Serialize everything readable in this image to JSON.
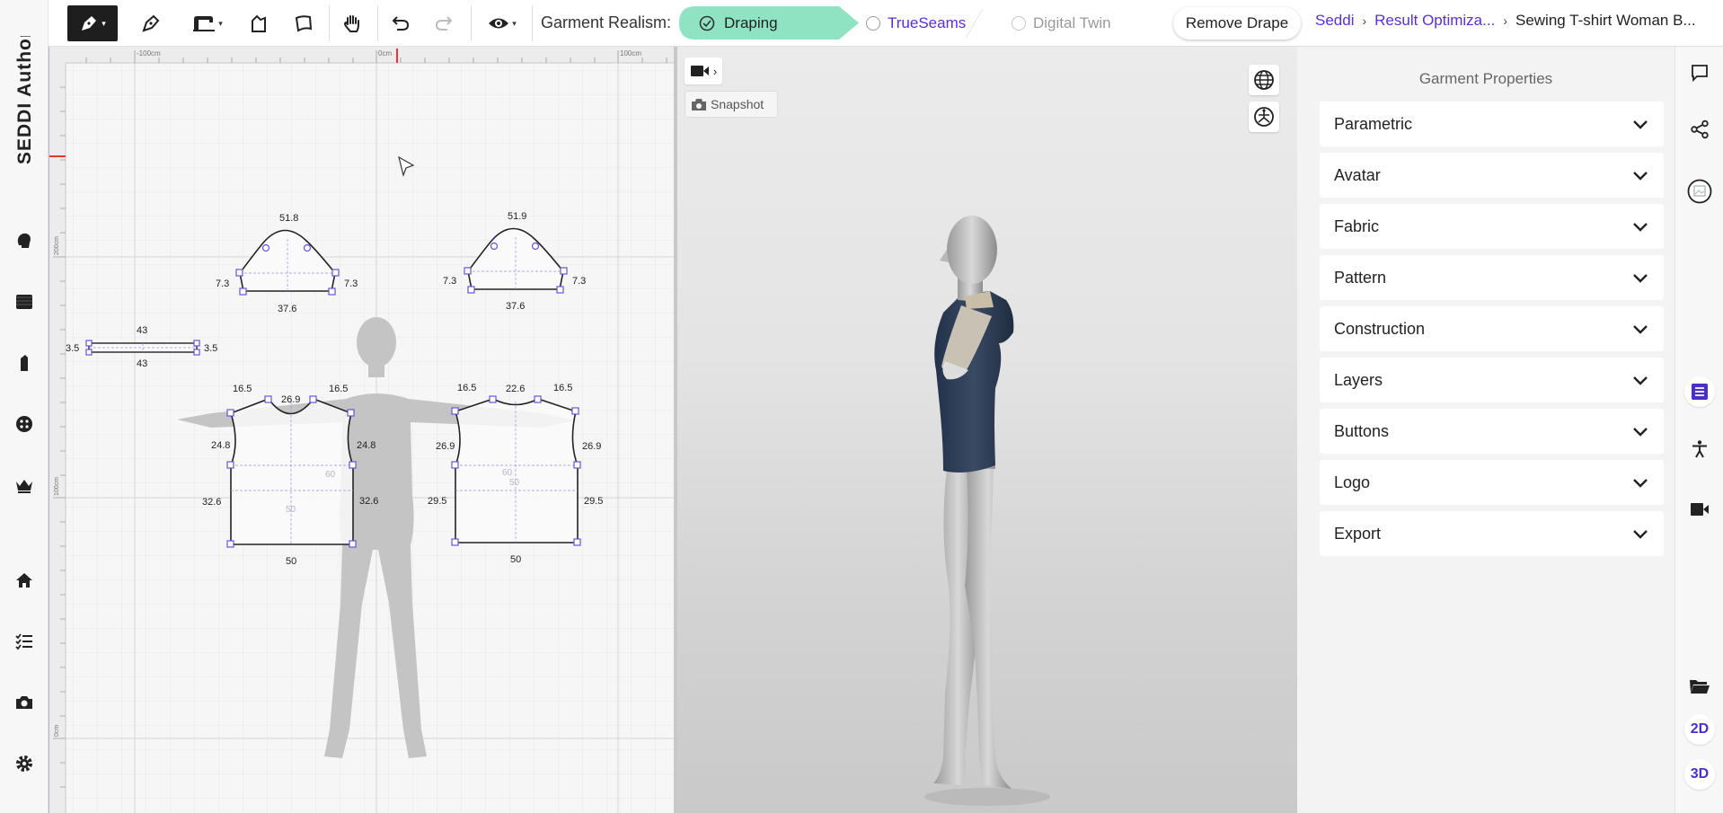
{
  "app": {
    "logo_text": "SEDDI Author"
  },
  "toolbar": {
    "realism_label": "Garment Realism:",
    "modes": [
      {
        "label": "Draping",
        "state": "active"
      },
      {
        "label": "TrueSeams",
        "state": "available"
      },
      {
        "label": "Digital Twin",
        "state": "disabled"
      }
    ],
    "remove_drape_label": "Remove Drape",
    "breadcrumb": [
      {
        "label": "Seddi",
        "link": true
      },
      {
        "label": "Result Optimiza...",
        "link": true
      },
      {
        "label": "Sewing T-shirt Woman B...",
        "link": false
      }
    ],
    "icons": [
      "pen-select-icon",
      "pen-icon",
      "sewing-machine-icon",
      "pattern-piece-icon",
      "pattern-shape-icon",
      "hand-pan-icon",
      "undo-icon",
      "redo-icon",
      "visibility-icon"
    ]
  },
  "pattern_view": {
    "ruler_top": [
      "-100cm",
      "0cm",
      "100cm"
    ],
    "ruler_left": [
      "200cm",
      "100cm",
      "0cm"
    ],
    "sleeve_left": {
      "top": "51.8",
      "left": "7.3",
      "right": "7.3",
      "bottom": "37.6"
    },
    "sleeve_right": {
      "top": "51.9",
      "left": "7.3",
      "right": "7.3",
      "bottom": "37.6"
    },
    "band": {
      "top": "43",
      "bottom": "43",
      "left": "3.5",
      "right": "3.5"
    },
    "front": {
      "shoulder_left": "16.5",
      "neck": "26.9",
      "shoulder_right": "16.5",
      "arm_left": "24.8",
      "arm_right": "24.8",
      "side_left": "32.6",
      "side_right": "32.6",
      "bottom": "50",
      "inner_a": "60",
      "inner_b": "50"
    },
    "back": {
      "shoulder_left": "16.5",
      "neck": "22.6",
      "shoulder_right": "16.5",
      "arm_left": "26.9",
      "arm_right": "26.9",
      "side_left": "29.5",
      "side_right": "29.5",
      "bottom": "50",
      "inner_a": "60",
      "inner_b": "50"
    }
  },
  "viewer3d": {
    "snapshot_label": "Snapshot"
  },
  "properties": {
    "title": "Garment Properties",
    "sections": [
      "Parametric",
      "Avatar",
      "Fabric",
      "Pattern",
      "Construction",
      "Layers",
      "Buttons",
      "Logo",
      "Export"
    ]
  },
  "rightbar": {
    "view_2d": "2D",
    "view_3d": "3D"
  },
  "colors": {
    "accent": "#5b2fd0",
    "draping_chip": "#8fe3c2",
    "garment": "#2f3e55",
    "pattern_handle": "#6a4fd6"
  }
}
